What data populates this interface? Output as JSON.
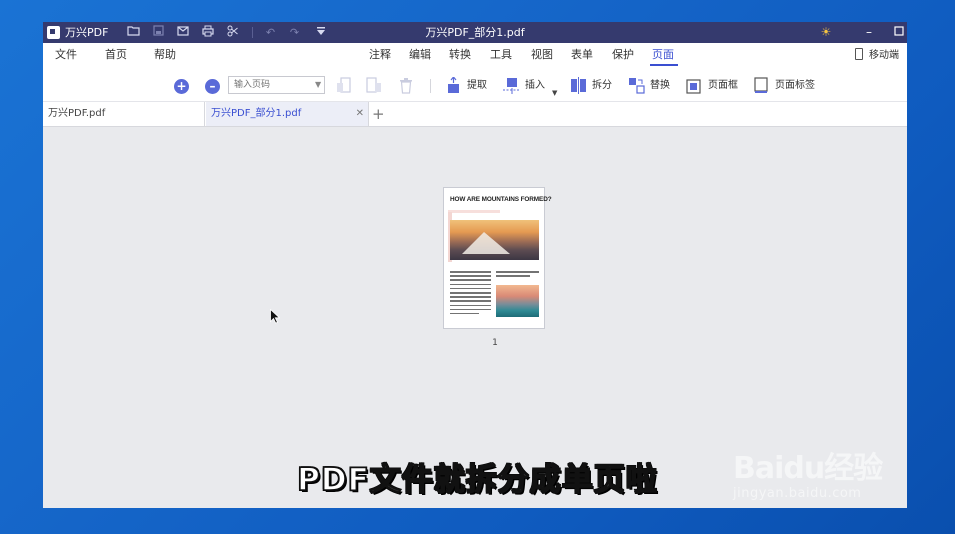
{
  "app": {
    "name": "万兴PDF",
    "window_title": "万兴PDF_部分1.pdf"
  },
  "menu": {
    "items": [
      "文件",
      "首页",
      "帮助",
      "注释",
      "编辑",
      "转换",
      "工具",
      "视图",
      "表单",
      "保护",
      "页面"
    ],
    "active": "页面",
    "mobile_label": "移动端"
  },
  "toolbar": {
    "page_input_placeholder": "输入页码",
    "extract": "提取",
    "insert": "插入",
    "split": "拆分",
    "replace": "替换",
    "page_box": "页面框",
    "page_label": "页面标签"
  },
  "tabs": [
    {
      "label": "万兴PDF.pdf",
      "active": false
    },
    {
      "label": "万兴PDF_部分1.pdf",
      "active": true
    }
  ],
  "document": {
    "thumbnail_title": "HOW ARE MOUNTAINS FORMED?",
    "page_number": "1"
  },
  "subtitle": "PDF文件就拆分成单页啦",
  "watermark": {
    "brand": "Baidu经验",
    "url": "jingyan.baidu.com"
  },
  "colors": {
    "titlebar": "#353a6e",
    "accent": "#3a4fd1",
    "desktop": "#1565c8"
  }
}
